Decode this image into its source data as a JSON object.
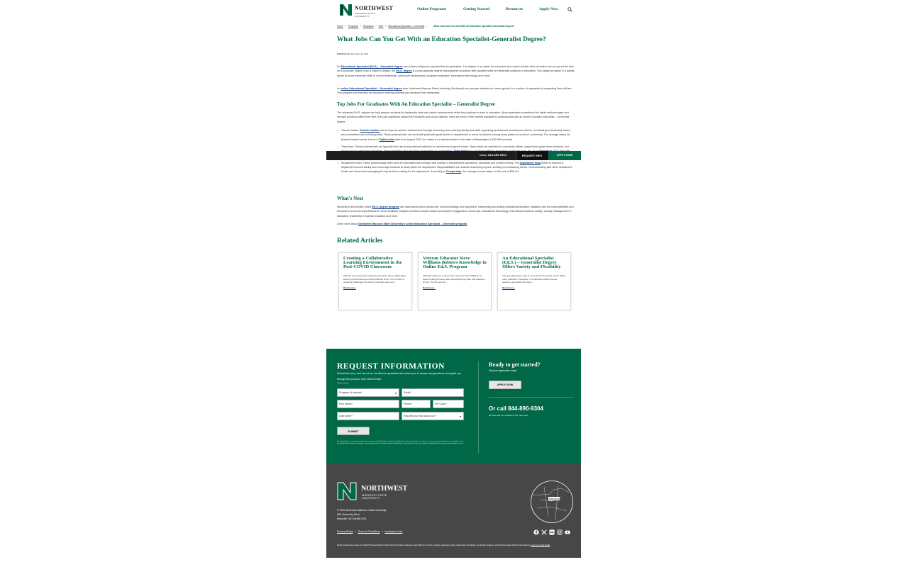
{
  "header": {
    "logo_word": "NORTHWEST",
    "logo_sub": "MISSOURI STATE UNIVERSITY",
    "nav": [
      "Online Programs",
      "Getting Started",
      "Resources",
      "Apply Now"
    ]
  },
  "breadcrumb": {
    "items": [
      "Home",
      "Programs",
      "Education",
      "EDS",
      "Educational Specialist – Generalist"
    ],
    "current": "What Jobs Can You Get With an Education Specialist-Generalist Degree?"
  },
  "article": {
    "title": "What Jobs Can You Get With an Education Specialist-Generalist Degree?",
    "published_label": "Published On:",
    "published_date": "December 22, 2022",
    "p1_a": "An ",
    "p1_link1": "Educational Specialist (Ed.S.) – Generalist degree",
    "p1_b": " can create multiple job opportunities for graduates. The degree is an option for educators who want to further their education but not spend the time on a doctorate. Higher than a master's degree, the ",
    "p1_link2": "Ed.S. degree",
    "p1_c": " is a post-graduate degree that prepares educators with valuable skills for leadership positions in education. This degree program is a quality option to boost advanced skills in school leadership, curriculum development, program evaluation, educational technology and more.",
    "p2_a": "An ",
    "p2_link": "online Educational Specialist – Generalist degree",
    "p2_b": " from Northwest Missouri State University (Northwest) can prepare students for career growth in a number of capacities by expanding their skill set. This program can increase an educator's earning potential and enhance their credentials.",
    "h2_jobs": "Top Jobs For Graduates With An Education Specialist – Generalist Degree",
    "p3": "The advanced Ed.S. degree can help prepare students for leadership roles and career advancement while they continue to work in education. When graduates understand the latest methodologies and relevant practices within their field, they can significant impact their students and school districts. Here are some of the careers available to professionals with an online Education Specialist – Generalist degree.",
    "li1_a": "Teacher leader: ",
    "li1_link": "Teacher leaders",
    "li1_b": " aim to improve student achievement through mentoring and coaching faculty and staff, organizing professional development efforts, contributing to leadership teams and committees and collecting data. These professionals can work with particular grade levels or departments or serve as liaisons among many parties of a school community. The average salary for teacher leaders varies, but as of ",
    "li1_link2": "ZipRecruiter",
    "li1_c": " data from August 2022, the salary for a teacher leader in the state of Washington is $42,560 annually.",
    "li2_a": "Team lead: These professionals are typically hired by an educational institution to oversee and support a team. Team leads are expected to coordinate efforts, support and guide team members, and review work to meet high standards. Responsibilities may vary from organization to organization. ",
    "li2_link": "Team leaders",
    "li2_b": " in academic settings are hired to guide the work, etc. As of ",
    "li2_link2": "Glassdoor",
    "li2_c": " 2022 data, the average annual salary for an education team lead is $57,668.",
    "li3_a": "Department head: These professionals often work at universities and colleges and oversee a department's operations, standards and overall running. The ",
    "li3_link": "department head",
    "li3_b": " works to improve a department and its faculty and encourage students to study within the department. Responsibilities can include developing reports, working on fundraising efforts, communicating with other department heads and alumni and managing the big decision-making for the department. According to ",
    "li3_link2": "Comparably",
    "li3_c": ", the average annual salary for this role is $96,411.",
    "h2_next": "What's Next",
    "p4_a": "Students in this flexible online ",
    "p4_link": "Ed.S. degree program",
    "p4_b": " can learn about school personnel, school buildings and equipment, interpreting and writing educational literature, statistics and the responsibilities and functions of a school superintendent. Some available program electives include culture and student engagement, school law, educational technology, instructional systems design, change management in education, leadership in special education and more.",
    "p5_a": "Learn more about ",
    "p5_link": "Northwest Missouri State University's online Education Specialist – Generalist program",
    "p5_b": "."
  },
  "sticky": {
    "call": "CALL 844-890-9304",
    "request": "REQUEST INFO",
    "apply": "APPLY NOW"
  },
  "related": {
    "title": "Related Articles",
    "cards": [
      {
        "title": "Creating a Collaborative Learning Environment in the Post-COVID Classroom",
        "excerpt": "With the new school year underway, educators agree collaborative learning environments are where students thrive. The COVID-19 pandemic challenged the world in countless ways and…",
        "more": "Read more ›"
      },
      {
        "title": "Veteran Educator Steve Williams Bolsters Knowledge in Online Ed.S. Program",
        "excerpt": "Although retirement is around the corner for Steve Williams, he plans to keep his career alive and kicking long after that milestone arrives. The 63-year-old…",
        "more": "Read more ›"
      },
      {
        "title": "An Educational Specialist (Ed.S.) – Generalist Degree Offers Variety and Flexibility",
        "excerpt": "The generalist career path is not limited to the private sector. While many educators \"specialize\" in a particular subject area as teachers, generalists also work…",
        "more": "Read more ›"
      }
    ]
  },
  "request": {
    "heading": "REQUEST INFORMATION",
    "sub": "Submit this form, and one of our enrollment specialists will contact you to answer any questions and guide you through the process, from start to finish.",
    "required_note": "*All fields required",
    "fields": {
      "program": "Program of Interest*",
      "email": "Email*",
      "first": "First Name*",
      "phone": "Phone*",
      "zip": "ZIP Code*",
      "last": "Last Name*",
      "hear": "How did you hear about us?*"
    },
    "submit": "SUBMIT",
    "disclaimer": "By submitting this form, I am providing my digital signature agreeing that Northwest Missouri State University (Northwest) and its agent, Noodle, may email me or contact me regarding educational services by telephone and/or text message utilizing automated technology or a pre-recorded message at the telephone number(s) provided above. I understand this consent is not a condition to attend Northwest or to purchase any other goods or services.",
    "ready": "Ready to get started?",
    "ready_sub": "Start your application today!",
    "apply": "APPLY NOW",
    "or_call": "Or call 844-890-9304",
    "or_call_sub": "for help with any questions you may have."
  },
  "footer": {
    "logo_word": "NORTHWEST",
    "logo_sub": "MISSOURI STATE UNIVERSITY",
    "copyright": "© 2024 Northwest Missouri State University",
    "address1": "800 University Drive",
    "address2": "Maryville, MO 64468 USA",
    "links": [
      "Privacy Policy",
      "Terms & Conditions",
      "nwmissouri.edu"
    ],
    "note_a": "Noodle maintains this website on behalf of Northwest Missouri State University. Northwest maintains responsibility for curriculum, teaching, admissions, tuition, financial aid, accreditation, and all other academic- and instruction-related functions and decisions. ",
    "note_link": "Learn more about Noodle",
    "note_b": ".",
    "map_label": "MARYVILLE",
    "social": [
      "facebook-icon",
      "x-icon",
      "flickr-icon",
      "instagram-icon",
      "youtube-icon"
    ]
  },
  "colors": {
    "brand_green": "#006747",
    "footer_gray": "#474747",
    "link_blue": "#0b3b86",
    "sticky_dark": "#1d1d1d"
  }
}
